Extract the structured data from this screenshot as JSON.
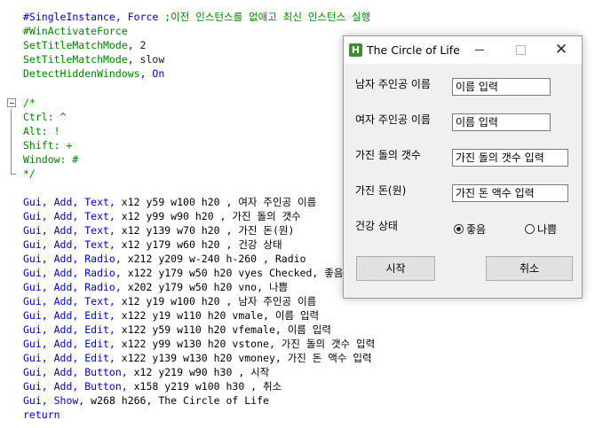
{
  "code": {
    "header_lines": [
      {
        "kw": "#SingleInstance",
        "rest": ", Force ",
        "cmt": ";이전 인스턴스를 없애고 최신 인스턴스 실행"
      },
      {
        "kw": "#WinActivateForce",
        "rest": "",
        "cmt": ""
      },
      {
        "kw": "SetTitleMatchMode",
        "rest": ", 2",
        "cmt": ""
      },
      {
        "kw": "SetTitleMatchMode",
        "rest": ", slow",
        "cmt": ""
      },
      {
        "kw": "DetectHiddenWindows",
        "rest": ", On",
        "cmt": ""
      }
    ],
    "comment_block": [
      "/*",
      "Ctrl: ^",
      "Alt: !",
      "Shift: +",
      "Window: #",
      "*/"
    ],
    "gui_lines": [
      {
        "p1": "Gui, Add, Text,",
        "p2": " x12 y59 w100 h20 , 여자 주인공 이름"
      },
      {
        "p1": "Gui, Add, Text,",
        "p2": " x12 y99 w90 h20 , 가진 돌의 갯수"
      },
      {
        "p1": "Gui, Add, Text,",
        "p2": " x12 y139 w70 h20 , 가진 돈(원)"
      },
      {
        "p1": "Gui, Add, Text,",
        "p2": " x12 y179 w60 h20 , 건강 상태"
      },
      {
        "p1": "Gui, Add, Radio,",
        "p2": " x212 y209 w-240 h-260 , Radio"
      },
      {
        "p1": "Gui, Add, Radio,",
        "p2": " x122 y179 w50 h20 vyes Checked, 좋음"
      },
      {
        "p1": "Gui, Add, Radio,",
        "p2": " x202 y179 w50 h20 vno, 나쁨"
      },
      {
        "p1": "Gui, Add, Text,",
        "p2": " x12 y19 w100 h20 , 남자 주인공 이름"
      },
      {
        "p1": "Gui, Add, Edit,",
        "p2": " x122 y19 w110 h20 vmale, 이름 입력"
      },
      {
        "p1": "Gui, Add, Edit,",
        "p2": " x122 y59 w110 h20 vfemale, 이름 입력"
      },
      {
        "p1": "Gui, Add, Edit,",
        "p2": " x122 y99 w130 h20 vstone, 가진 돌의 갯수 입력"
      },
      {
        "p1": "Gui, Add, Edit,",
        "p2": " x122 y139 w130 h20 vmoney, 가진 돈 액수 입력"
      },
      {
        "p1": "Gui, Add, Button,",
        "p2": " x12 y219 w90 h30 , 시작"
      },
      {
        "p1": "Gui, Add, Button,",
        "p2": " x158 y219 w100 h30 , 취소"
      },
      {
        "p1": "Gui, Show,",
        "p2": " w268 h266, The Circle of Life"
      }
    ],
    "return_line": "return"
  },
  "window": {
    "title": "The Circle of Life",
    "icon_letter": "H",
    "close_glyph": "✕",
    "labels": {
      "male_name": "남자 주인공 이름",
      "female_name": "여자 주인공 이름",
      "stone_count": "가진 돌의 갯수",
      "money": "가진 돈(원)",
      "health": "건강 상태"
    },
    "fields": {
      "male_name": "이름 입력",
      "female_name": "이름 입력",
      "stone_count": "가진 돌의 갯수 입력",
      "money": "가진 돈 액수 입력"
    },
    "radios": {
      "good": "좋음",
      "bad": "나쁨",
      "selected": "good"
    },
    "buttons": {
      "start": "시작",
      "cancel": "취소"
    }
  }
}
